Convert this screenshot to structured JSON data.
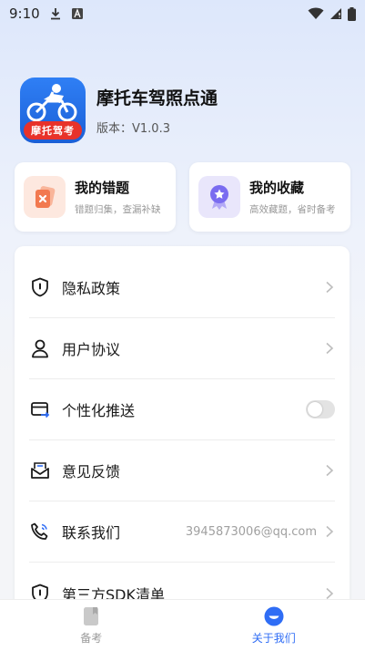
{
  "status_bar": {
    "time": "9:10",
    "icons": [
      "download-icon",
      "font-a-icon",
      "wifi-icon",
      "signal-icon",
      "battery-icon"
    ]
  },
  "app": {
    "name": "摩托车驾照点通",
    "version": "版本：V1.0.3",
    "logo_text": "摩托驾考"
  },
  "quick_cards": [
    {
      "title": "我的错题",
      "subtitle": "错题归集，查漏补缺",
      "icon": "wrong-questions-icon",
      "color": "#f2794f"
    },
    {
      "title": "我的收藏",
      "subtitle": "高效藏题，省时备考",
      "icon": "favorites-badge-icon",
      "color": "#7a6cf0"
    }
  ],
  "menu": [
    {
      "label": "隐私政策",
      "icon": "shield-icon",
      "control": "chevron"
    },
    {
      "label": "用户协议",
      "icon": "user-icon",
      "control": "chevron"
    },
    {
      "label": "个性化推送",
      "icon": "push-card-icon",
      "control": "toggle",
      "toggle_on": false
    },
    {
      "label": "意见反馈",
      "icon": "feedback-icon",
      "control": "chevron"
    },
    {
      "label": "联系我们",
      "icon": "phone-icon",
      "control": "chevron",
      "value": "3945873006@qq.com"
    },
    {
      "label": "第三方SDK清单",
      "icon": "sdk-list-icon",
      "control": "chevron"
    }
  ],
  "tabs": [
    {
      "label": "备考",
      "icon": "book-icon",
      "active": false
    },
    {
      "label": "关于我们",
      "icon": "about-icon",
      "active": true
    }
  ],
  "colors": {
    "accent": "#2f6df5",
    "card_orange": "#f2794f",
    "card_purple": "#7a6cf0"
  }
}
